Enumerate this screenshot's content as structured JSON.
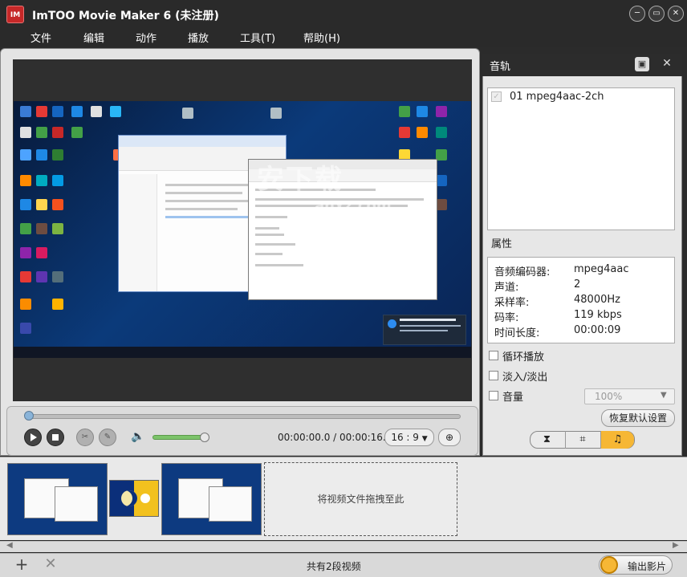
{
  "window": {
    "logo_text": "IM",
    "title": "ImTOO Movie Maker 6 (未注册)",
    "controls": {
      "minimize": "─",
      "restore": "▭",
      "close": "✕"
    }
  },
  "menu": [
    "文件",
    "编辑",
    "动作",
    "播放",
    "工具(T)",
    "帮助(H)"
  ],
  "preview": {
    "watermark": "安下载",
    "watermark_sub": "anxz.com"
  },
  "player": {
    "timecode": "00:00:00.0 / 00:00:16.6",
    "aspect": "16 : 9",
    "seek_position": 0,
    "volume_level": 0.85
  },
  "audio_panel": {
    "title": "音轨",
    "tracks": [
      {
        "label": "01 mpeg4aac-2ch",
        "checked": true
      }
    ],
    "properties_title": "属性",
    "properties": [
      {
        "key": "音频编码器:",
        "value": "mpeg4aac"
      },
      {
        "key": "声道:",
        "value": "2"
      },
      {
        "key": "采样率:",
        "value": "48000Hz"
      },
      {
        "key": "码率:",
        "value": "119 kbps"
      },
      {
        "key": "时间长度:",
        "value": "00:00:09"
      }
    ],
    "options": [
      {
        "label": "循环播放",
        "checked": false
      },
      {
        "label": "淡入/淡出",
        "checked": false
      },
      {
        "label": "音量",
        "checked": false
      }
    ],
    "volume_value": "100%",
    "reset_label": "恢复默认设置",
    "tabs": [
      "video-tab",
      "crop-tab",
      "audio-tab"
    ]
  },
  "timeline": {
    "drop_zone_text": "将视频文件拖拽至此"
  },
  "bottom": {
    "add": "+",
    "remove": "✕",
    "status": "共有2段视频",
    "export_label": "输出影片"
  },
  "colors": {
    "accent": "#f6b735",
    "titlebar": "#2a2a2a",
    "volume": "#7cc36a"
  }
}
